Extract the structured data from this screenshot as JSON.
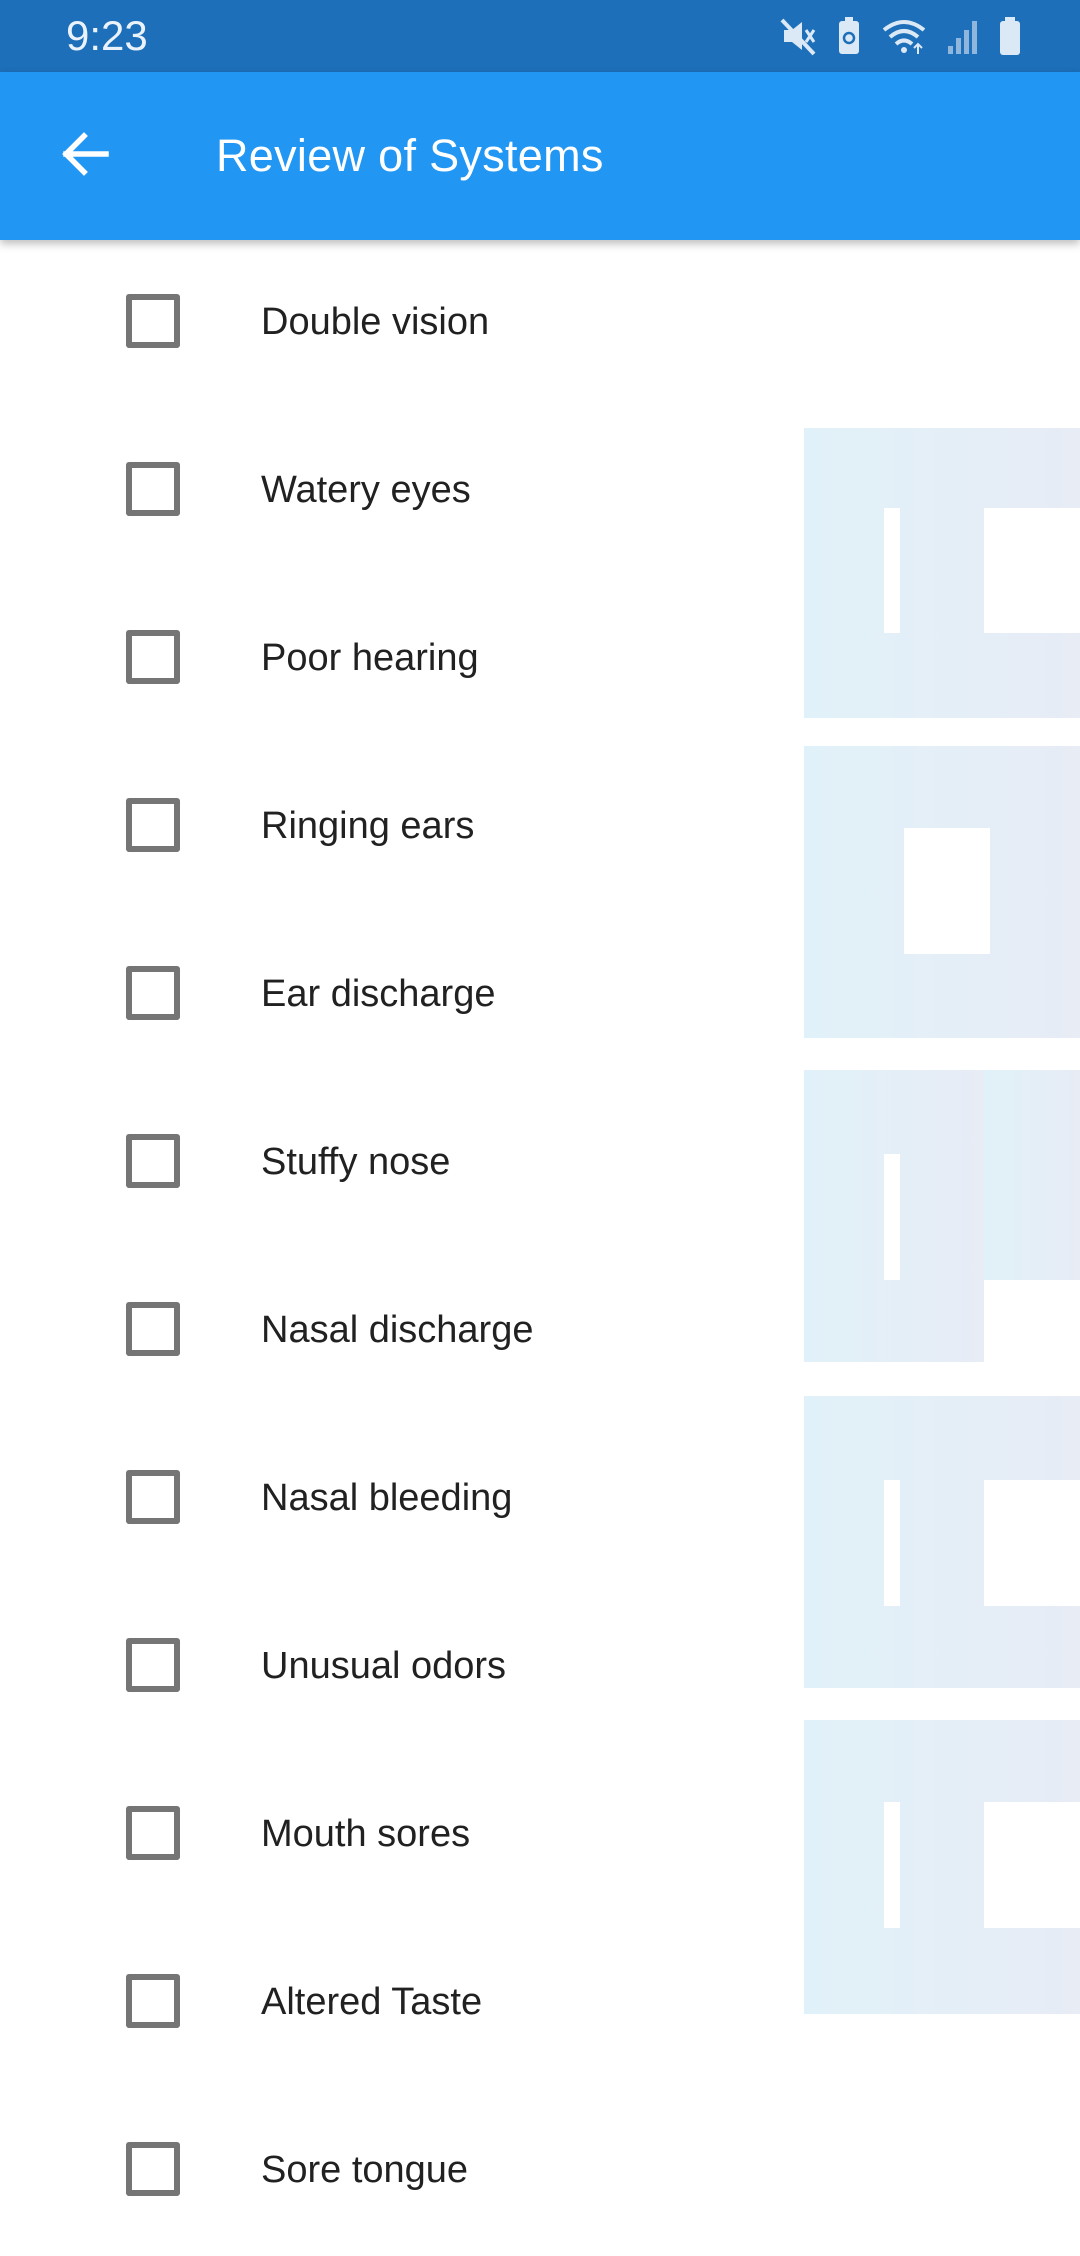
{
  "status_bar": {
    "time": "9:23",
    "icons": [
      "mute-icon",
      "battery-saver-icon",
      "wifi-icon",
      "signal-icon",
      "battery-icon"
    ]
  },
  "app_bar": {
    "title": "Review of Systems",
    "back_icon": "arrow-back-icon",
    "background": "#2196f3"
  },
  "items": [
    {
      "label": "Double vision",
      "checked": false
    },
    {
      "label": "Watery eyes",
      "checked": false
    },
    {
      "label": "Poor hearing",
      "checked": false
    },
    {
      "label": "Ringing ears",
      "checked": false
    },
    {
      "label": "Ear discharge",
      "checked": false
    },
    {
      "label": "Stuffy nose",
      "checked": false
    },
    {
      "label": "Nasal discharge",
      "checked": false
    },
    {
      "label": "Nasal bleeding",
      "checked": false
    },
    {
      "label": "Unusual odors",
      "checked": false
    },
    {
      "label": "Mouth sores",
      "checked": false
    },
    {
      "label": "Altered Taste",
      "checked": false
    },
    {
      "label": "Sore tongue",
      "checked": false
    }
  ]
}
